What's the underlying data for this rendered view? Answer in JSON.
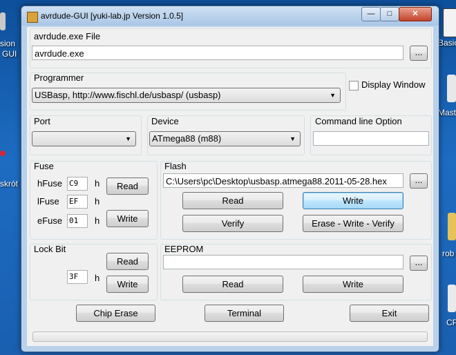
{
  "desktop": {
    "left_labels": [
      "sion",
      "GUI",
      "skrót"
    ],
    "right_labels": [
      "Basic",
      "Mast",
      "rob",
      "CP"
    ]
  },
  "window": {
    "title": "avrdude-GUI [yuki-lab.jp Version 1.0.5]",
    "caption_minimize": "—",
    "caption_maximize": "□",
    "caption_close": "✕"
  },
  "avrdude": {
    "label": "avrdude.exe File",
    "value": "avrdude.exe",
    "browse": "..."
  },
  "programmer": {
    "label": "Programmer",
    "selected": "USBasp, http://www.fischl.de/usbasp/ (usbasp)",
    "display_window_label": "Display Window",
    "display_window_checked": false
  },
  "port": {
    "label": "Port",
    "selected": ""
  },
  "device": {
    "label": "Device",
    "selected": "ATmega88 (m88)"
  },
  "cmdline": {
    "label": "Command line Option",
    "value": ""
  },
  "fuse": {
    "label": "Fuse",
    "hfuse_label": "hFuse",
    "hfuse_value": "C9",
    "lfuse_label": "lFuse",
    "lfuse_value": "EF",
    "efuse_label": "eFuse",
    "efuse_value": "01",
    "hex_suffix": "h",
    "read": "Read",
    "write": "Write"
  },
  "flash": {
    "label": "Flash",
    "path": "C:\\Users\\pc\\Desktop\\usbasp.atmega88.2011-05-28.hex",
    "browse": "...",
    "read": "Read",
    "write": "Write",
    "verify": "Verify",
    "erase_write_verify": "Erase - Write - Verify"
  },
  "lockbit": {
    "label": "Lock Bit",
    "value": "3F",
    "hex_suffix": "h",
    "read": "Read",
    "write": "Write"
  },
  "eeprom": {
    "label": "EEPROM",
    "path": "",
    "browse": "...",
    "read": "Read",
    "write": "Write"
  },
  "footer": {
    "chip_erase": "Chip Erase",
    "terminal": "Terminal",
    "exit": "Exit"
  },
  "progress": {
    "fraction": 0.0
  }
}
